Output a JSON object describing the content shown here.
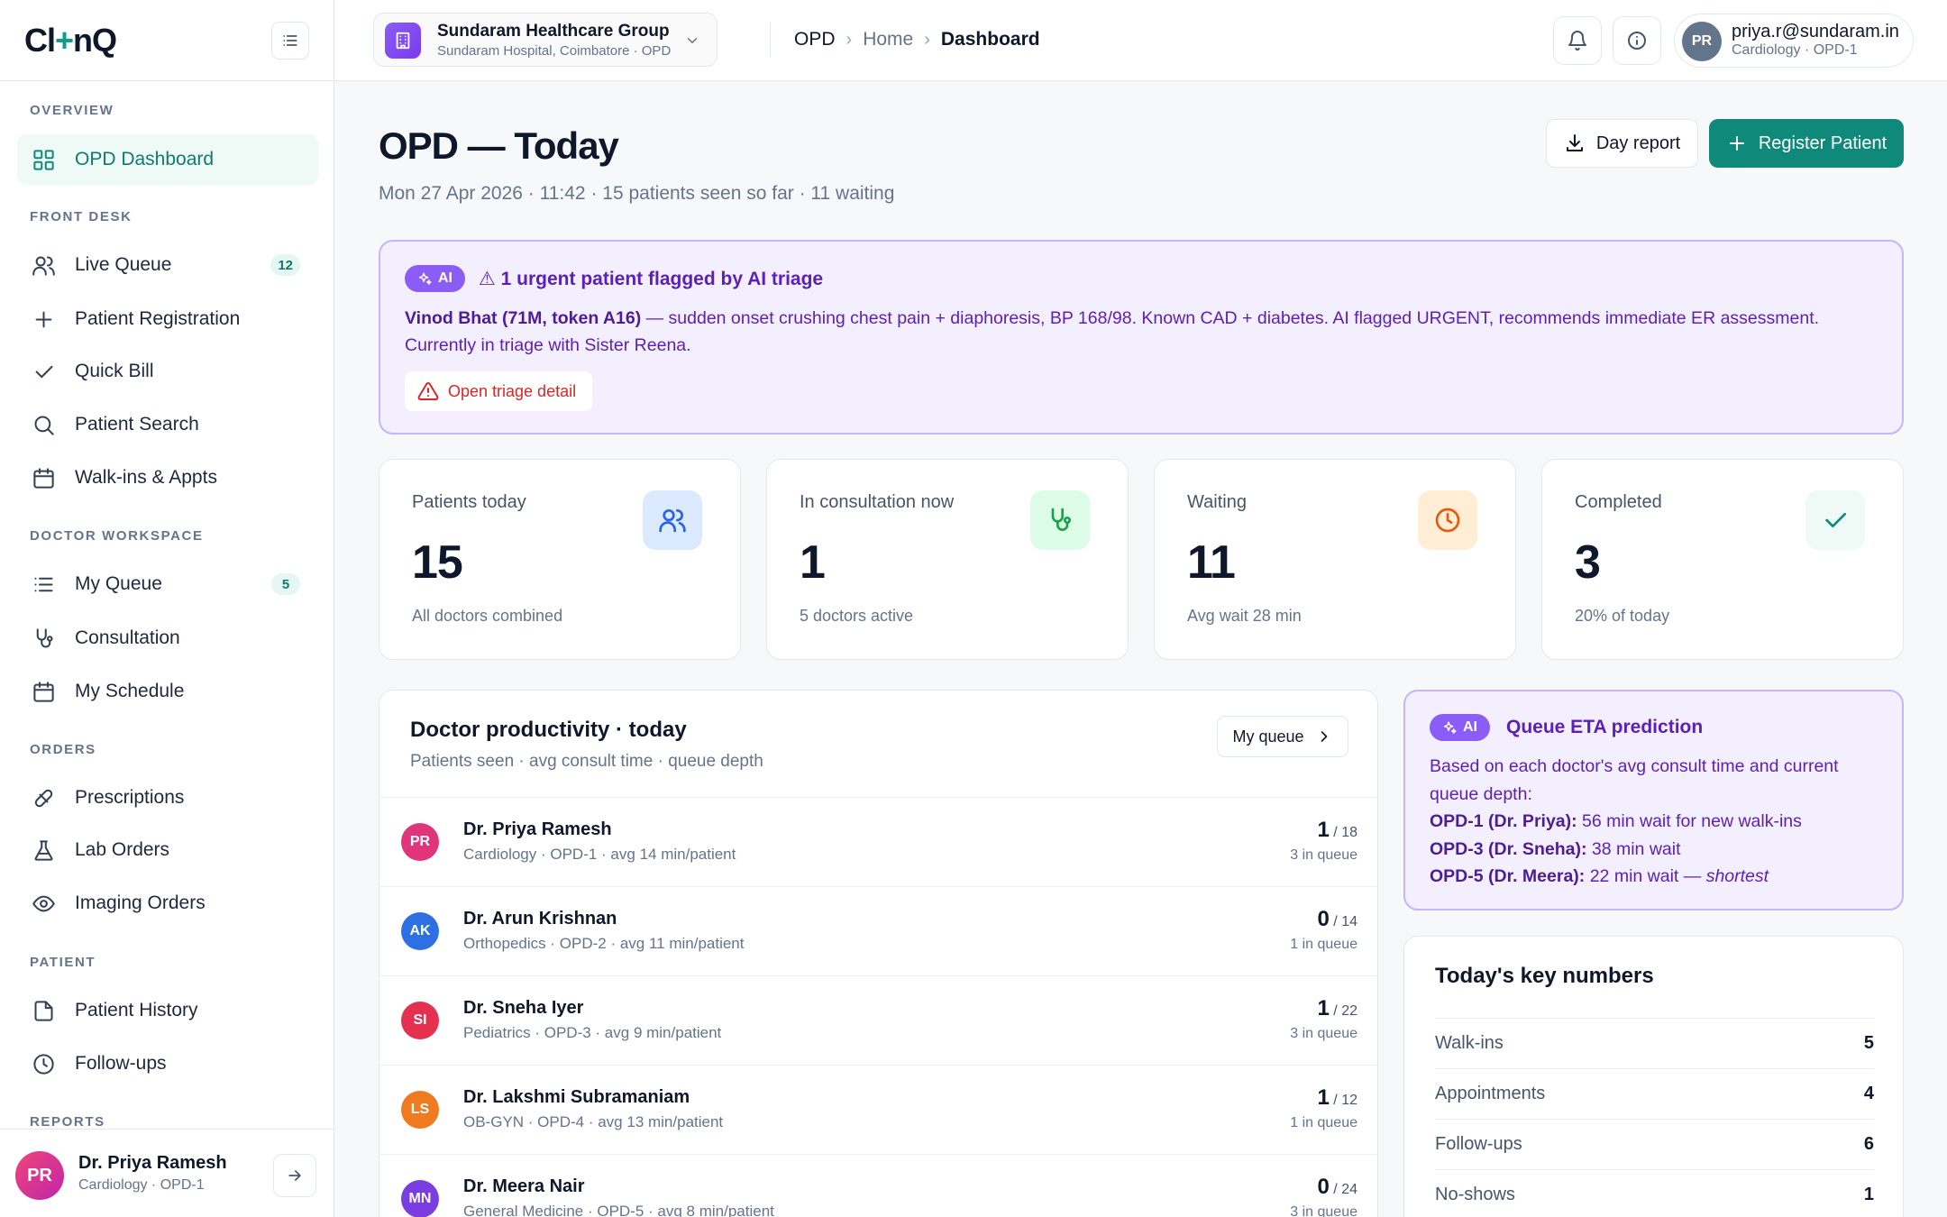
{
  "app": {
    "logo_left": "Cl",
    "logo_plus": "+",
    "logo_right": "nQ"
  },
  "sidebar": {
    "sections": {
      "overview": "OVERVIEW",
      "front_desk": "FRONT DESK",
      "doctor_workspace": "DOCTOR WORKSPACE",
      "orders": "ORDERS",
      "patient": "PATIENT",
      "reports": "REPORTS"
    },
    "items": {
      "opd_dashboard": "OPD Dashboard",
      "live_queue": "Live Queue",
      "live_queue_badge": "12",
      "patient_registration": "Patient Registration",
      "quick_bill": "Quick Bill",
      "patient_search": "Patient Search",
      "walkins": "Walk-ins & Appts",
      "my_queue": "My Queue",
      "my_queue_badge": "5",
      "consultation": "Consultation",
      "my_schedule": "My Schedule",
      "prescriptions": "Prescriptions",
      "lab_orders": "Lab Orders",
      "imaging_orders": "Imaging Orders",
      "patient_history": "Patient History",
      "follow_ups": "Follow-ups"
    },
    "user": {
      "initials": "PR",
      "name": "Dr. Priya Ramesh",
      "role": "Cardiology · OPD-1"
    }
  },
  "topbar": {
    "org_name": "Sundaram Healthcare Group",
    "org_sub": "Sundaram Hospital, Coimbatore · OPD",
    "breadcrumb": [
      "OPD",
      "Home",
      "Dashboard"
    ],
    "breadcrumb_sep": "›",
    "user_initials": "PR",
    "user_email": "priya.r@sundaram.in",
    "user_role": "Cardiology · OPD-1"
  },
  "page": {
    "title": "OPD — Today",
    "subtitle": "Mon 27 Apr 2026 · 11:42 · 15 patients seen so far · 11 waiting",
    "day_report": "Day report",
    "register_patient": "Register Patient"
  },
  "ai_alert": {
    "pill": "AI",
    "title": "⚠ 1 urgent patient flagged by AI triage",
    "patient": "Vinod Bhat (71M, token A16)",
    "text": " — sudden onset crushing chest pain + diaphoresis, BP 168/98. Known CAD + diabetes. AI flagged URGENT, recommends immediate ER assessment. Currently in triage with Sister Reena.",
    "button": "Open triage detail"
  },
  "stats": [
    {
      "label": "Patients today",
      "value": "15",
      "foot": "All doctors combined"
    },
    {
      "label": "In consultation now",
      "value": "1",
      "foot": "5 doctors active"
    },
    {
      "label": "Waiting",
      "value": "11",
      "foot": "Avg wait 28 min"
    },
    {
      "label": "Completed",
      "value": "3",
      "foot": "20% of today"
    }
  ],
  "colors": {
    "accent": "#0f8a7a",
    "ai": "#8b5cf6",
    "danger": "#dc2626"
  },
  "productivity": {
    "title": "Doctor productivity · today",
    "subtitle": "Patients seen · avg consult time · queue depth",
    "button": "My queue",
    "doctors": [
      {
        "initials": "PR",
        "name": "Dr. Priya Ramesh",
        "meta": "Cardiology · OPD-1 · avg 14 min/patient",
        "seen": "1",
        "total": " / 18",
        "queue": "3 in queue",
        "color": "#e0357a"
      },
      {
        "initials": "AK",
        "name": "Dr. Arun Krishnan",
        "meta": "Orthopedics · OPD-2 · avg 11 min/patient",
        "seen": "0",
        "total": " / 14",
        "queue": "1 in queue",
        "color": "#2f6fe4"
      },
      {
        "initials": "SI",
        "name": "Dr. Sneha Iyer",
        "meta": "Pediatrics · OPD-3 · avg 9 min/patient",
        "seen": "1",
        "total": " / 22",
        "queue": "3 in queue",
        "color": "#e5304f"
      },
      {
        "initials": "LS",
        "name": "Dr. Lakshmi Subramaniam",
        "meta": "OB-GYN · OPD-4 · avg 13 min/patient",
        "seen": "1",
        "total": " / 12",
        "queue": "1 in queue",
        "color": "#f07a1f"
      },
      {
        "initials": "MN",
        "name": "Dr. Meera Nair",
        "meta": "General Medicine · OPD-5 · avg 8 min/patient",
        "seen": "0",
        "total": " / 24",
        "queue": "3 in queue",
        "color": "#7a3ee0"
      }
    ]
  },
  "eta": {
    "pill": "AI",
    "title": "Queue ETA prediction",
    "intro": "Based on each doctor's avg consult time and current queue depth:",
    "l1_b": "OPD-1 (Dr. Priya):",
    "l1": " 56 min wait for new walk-ins",
    "l2_b": "OPD-3 (Dr. Sneha):",
    "l2": " 38 min wait",
    "l3_b": "OPD-5 (Dr. Meera):",
    "l3": " 22 min wait — ",
    "l3_i": "shortest"
  },
  "key_numbers": {
    "title": "Today's key numbers",
    "rows": [
      {
        "k": "Walk-ins",
        "v": "5"
      },
      {
        "k": "Appointments",
        "v": "4"
      },
      {
        "k": "Follow-ups",
        "v": "6"
      },
      {
        "k": "No-shows",
        "v": "1"
      }
    ]
  }
}
